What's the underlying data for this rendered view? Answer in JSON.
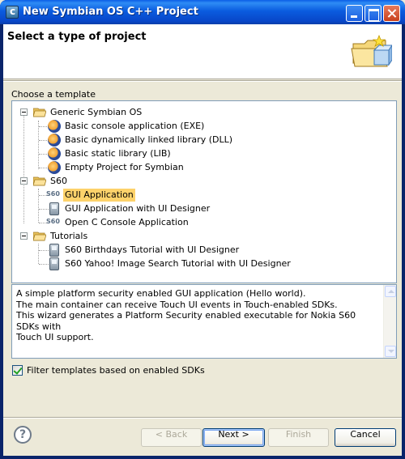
{
  "window": {
    "title": "New Symbian OS C++ Project",
    "app_icon": "carbide-c-icon"
  },
  "banner": {
    "title": "Select a type of project",
    "icon": "new-folder-wizard-icon"
  },
  "template_section": {
    "label": "Choose a template"
  },
  "tree": {
    "groups": [
      {
        "label": "Generic Symbian OS",
        "expanded": true,
        "items": [
          {
            "label": "Basic console application (EXE)",
            "icon": "eclipse-icon"
          },
          {
            "label": "Basic dynamically linked library (DLL)",
            "icon": "eclipse-icon"
          },
          {
            "label": "Basic static library (LIB)",
            "icon": "eclipse-icon"
          },
          {
            "label": "Empty Project for Symbian",
            "icon": "eclipse-icon"
          }
        ]
      },
      {
        "label": "S60",
        "expanded": true,
        "items": [
          {
            "label": "GUI Application",
            "icon": "s60-icon",
            "selected": true
          },
          {
            "label": "GUI Application with UI Designer",
            "icon": "phone-icon"
          },
          {
            "label": "Open C Console Application",
            "icon": "s60-icon"
          }
        ]
      },
      {
        "label": "Tutorials",
        "expanded": true,
        "items": [
          {
            "label": "S60 Birthdays Tutorial with UI Designer",
            "icon": "phone-icon"
          },
          {
            "label": "S60 Yahoo! Image Search Tutorial with UI Designer",
            "icon": "phone-icon"
          }
        ]
      }
    ]
  },
  "description": {
    "text": "A simple platform security enabled GUI application (Hello world).\nThe main container can receive Touch UI events in Touch-enabled SDKs.\nThis wizard generates a Platform Security enabled executable for Nokia S60 SDKs with\nTouch UI support."
  },
  "filter": {
    "label": "Filter templates based on enabled SDKs",
    "checked": true
  },
  "buttons": {
    "help": "?",
    "back": "< Back",
    "next": "Next >",
    "finish": "Finish",
    "cancel": "Cancel"
  }
}
